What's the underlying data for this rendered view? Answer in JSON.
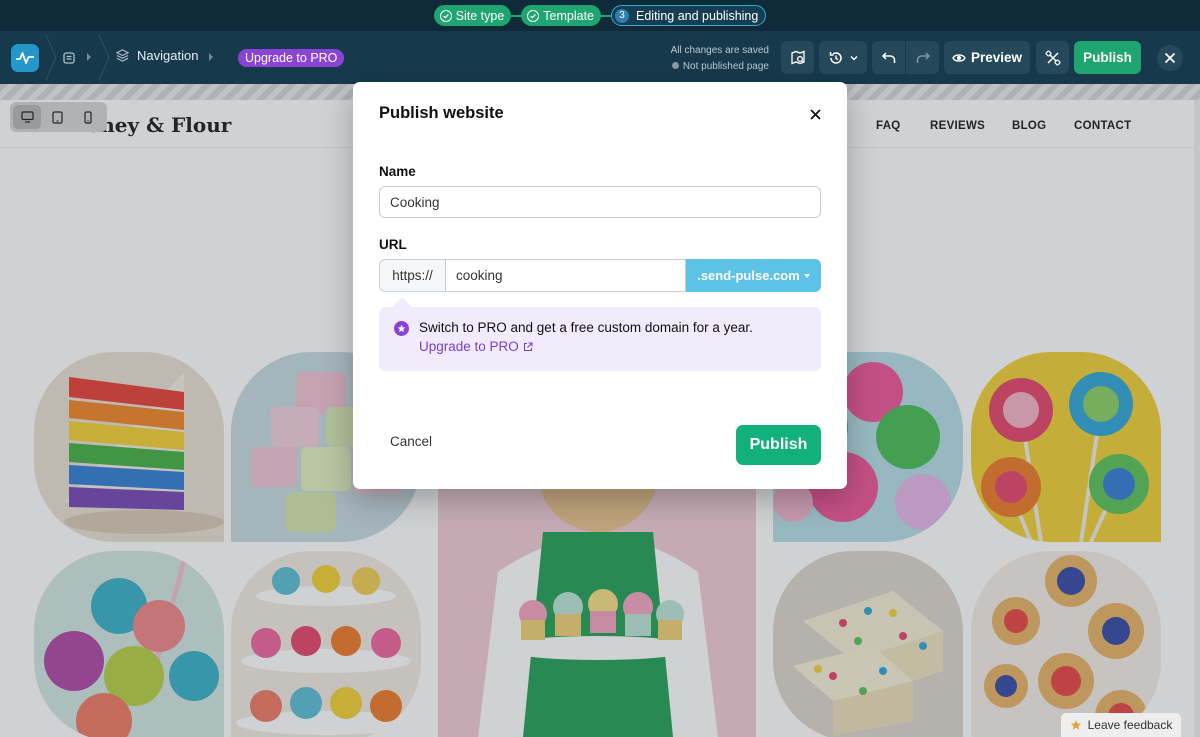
{
  "steps": [
    {
      "label": "Site type",
      "state": "done"
    },
    {
      "label": "Template",
      "state": "done"
    },
    {
      "number": "3",
      "label": "Editing and publishing",
      "state": "active"
    }
  ],
  "toolbar": {
    "breadcrumb_navigation": "Navigation",
    "upgrade_badge": "Upgrade to PRO",
    "save_status": "All changes are saved",
    "publish_status": "Not published page",
    "preview_label": "Preview",
    "publish_label": "Publish"
  },
  "icons": {
    "logo": "pulse-logo-icon",
    "page": "page-icon",
    "layers": "layers-icon",
    "seo": "map-search-icon",
    "history": "history-icon",
    "undo": "undo-icon",
    "redo": "redo-icon",
    "preview": "eye-icon",
    "settings": "tools-icon",
    "close": "close-icon"
  },
  "site": {
    "logo": "Honey & Flour",
    "nav": [
      "FAQ",
      "REVIEWS",
      "BLOG",
      "CONTACT"
    ],
    "devices": [
      "desktop",
      "tablet",
      "mobile"
    ]
  },
  "modal": {
    "title": "Publish website",
    "name_label": "Name",
    "name_value": "Cooking",
    "url_label": "URL",
    "url_prefix": "https://",
    "url_value": "cooking",
    "url_domain": ".send-pulse.com",
    "pro_message": "Switch to PRO and get a free custom domain for a year.",
    "pro_link": "Upgrade to PRO",
    "cancel_label": "Cancel",
    "publish_label": "Publish"
  },
  "feedback": "Leave feedback",
  "colors": {
    "accent_green": "#12b07a",
    "pro_purple": "#8b43d6",
    "domain_blue": "#5ec1e6",
    "toolbar_bg": "#163a4c"
  }
}
